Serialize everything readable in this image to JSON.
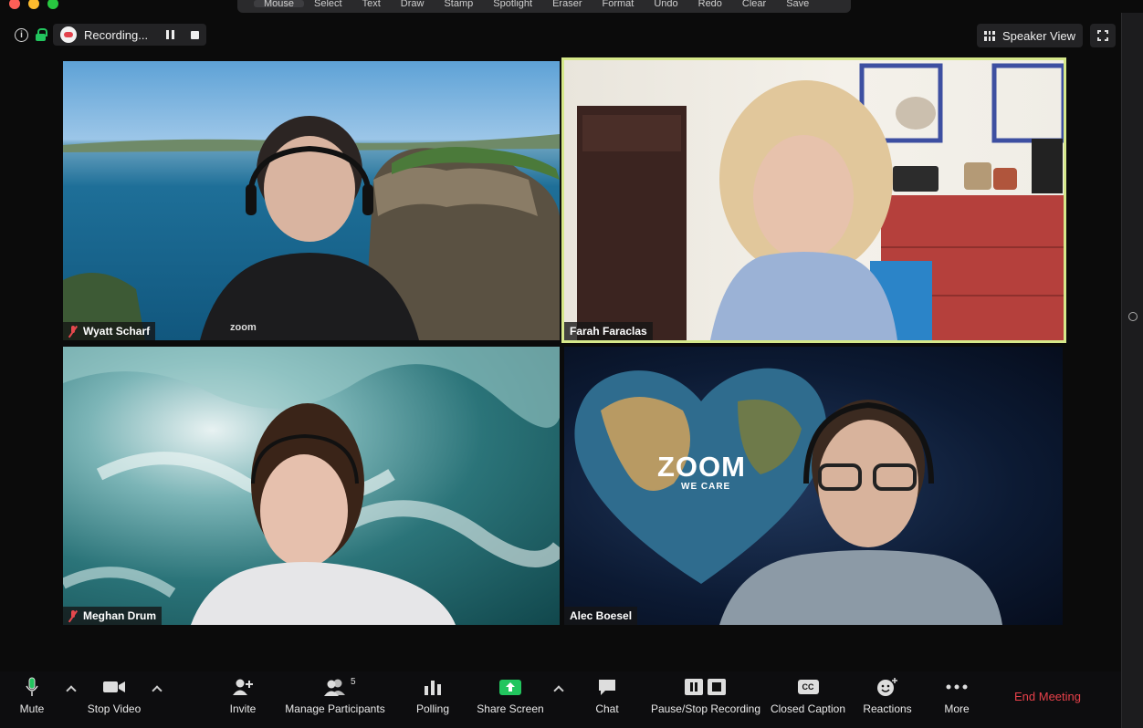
{
  "window": {
    "annotation_toolbar": [
      "Mouse",
      "Select",
      "Text",
      "Draw",
      "Stamp",
      "Spotlight",
      "Eraser",
      "Format",
      "Undo",
      "Redo",
      "Clear",
      "Save"
    ]
  },
  "topbar": {
    "recording_label": "Recording...",
    "view_label": "Speaker View"
  },
  "participants": [
    {
      "name": "Wyatt Scharf",
      "muted": true
    },
    {
      "name": "Farah Faraclas",
      "muted": false,
      "active_speaker": true
    },
    {
      "name": "Meghan Drum",
      "muted": true
    },
    {
      "name": "Alec Boesel",
      "muted": false
    }
  ],
  "background_text": {
    "brand": "ZOOM",
    "tagline": "WE CARE",
    "shirt_logo": "zoom"
  },
  "toolbar": {
    "mute": "Mute",
    "stop_video": "Stop Video",
    "invite": "Invite",
    "manage_participants": "Manage Participants",
    "participant_count": "5",
    "polling": "Polling",
    "share_screen": "Share Screen",
    "chat": "Chat",
    "pause_stop_recording": "Pause/Stop Recording",
    "closed_caption": "Closed Caption",
    "cc_badge": "CC",
    "reactions": "Reactions",
    "more": "More",
    "end_meeting": "End Meeting"
  },
  "colors": {
    "active_speaker_border": "#d6e88a",
    "end_meeting": "#e8414a",
    "share_green": "#22c55e",
    "muted_red": "#e5484d"
  }
}
